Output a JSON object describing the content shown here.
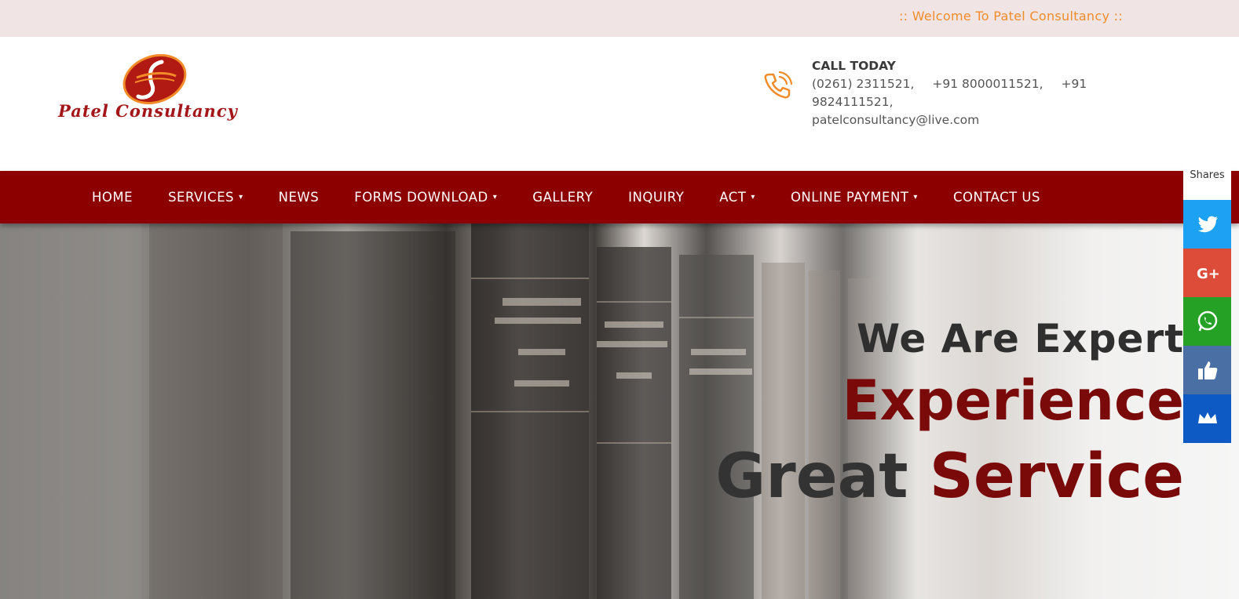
{
  "topbar": {
    "welcome": ":: Welcome To Patel Consultancy ::"
  },
  "logo": {
    "text": "Patel Consultancy",
    "icon": "pc-emblem-icon"
  },
  "contact": {
    "label": "CALL TODAY",
    "phones": [
      "(0261) 2311521,",
      "+91 8000011521,",
      "+91 9824111521,"
    ],
    "email": "patelconsultancy@live.com",
    "icon": "phone-icon"
  },
  "nav": {
    "items": [
      {
        "label": "HOME",
        "dropdown": false
      },
      {
        "label": "SERVICES",
        "dropdown": true
      },
      {
        "label": "NEWS",
        "dropdown": false
      },
      {
        "label": "FORMS DOWNLOAD",
        "dropdown": true
      },
      {
        "label": "GALLERY",
        "dropdown": false
      },
      {
        "label": "INQUIRY",
        "dropdown": false
      },
      {
        "label": "ACT",
        "dropdown": true
      },
      {
        "label": "ONLINE PAYMENT",
        "dropdown": true
      },
      {
        "label": "CONTACT US",
        "dropdown": false
      }
    ],
    "caret": "▾"
  },
  "hero": {
    "line1": "We Are  Expert",
    "line2": "Experience",
    "line3_a": "Great",
    "line3_b": "Service"
  },
  "share": {
    "label": "Shares",
    "buttons": [
      {
        "name": "twitter",
        "color": "#1da1f2",
        "icon": "twitter-icon"
      },
      {
        "name": "google-plus",
        "color": "#dd4b39",
        "icon": "google-plus-icon"
      },
      {
        "name": "whatsapp",
        "color": "#25a126",
        "icon": "whatsapp-icon"
      },
      {
        "name": "like",
        "color": "#4a6fa5",
        "icon": "thumbs-up-icon"
      },
      {
        "name": "sumo",
        "color": "#0e5ac5",
        "icon": "crown-icon"
      }
    ]
  },
  "colors": {
    "nav": "#8c0000",
    "accent": "#f28c28",
    "topbar": "#f0e4e4"
  }
}
